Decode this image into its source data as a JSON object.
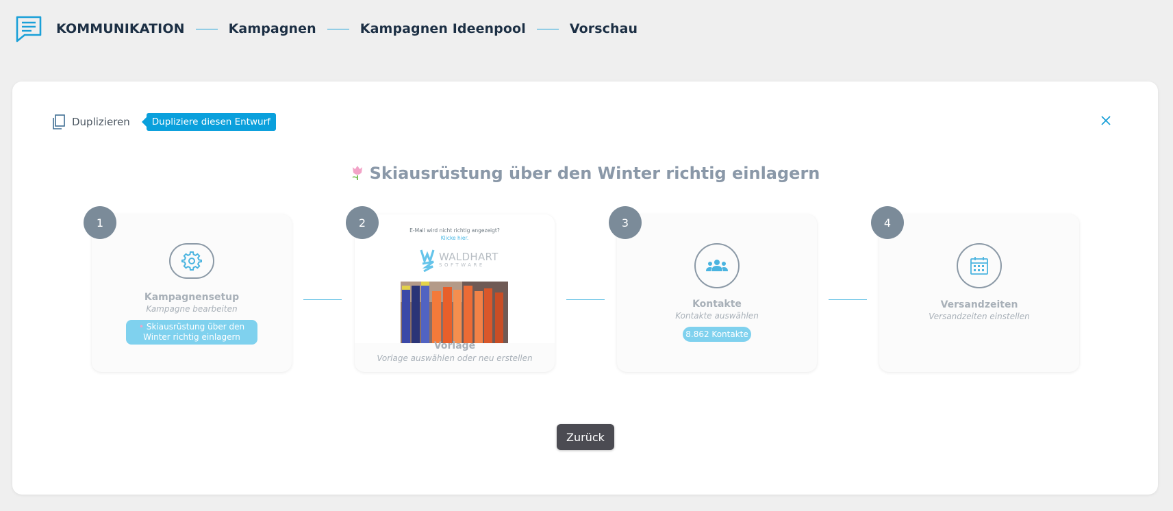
{
  "breadcrumb": {
    "items": [
      "KOMMUNIKATION",
      "Kampagnen",
      "Kampagnen Ideenpool",
      "Vorschau"
    ]
  },
  "toolbar": {
    "duplicate_label": "Duplizieren",
    "duplicate_tooltip": "Dupliziere diesen Entwurf"
  },
  "campaign": {
    "title": "Skiausrüstung über den Winter richtig einlagern"
  },
  "steps": [
    {
      "number": "1",
      "title": "Kampagnensetup",
      "subtitle": "Kampagne bearbeiten",
      "badge": "Skiausrüstung über den Winter richtig einlagern"
    },
    {
      "number": "2",
      "title": "Vorlage",
      "subtitle": "Vorlage auswählen oder neu erstellen",
      "preview_text": "E-Mail wird nicht richtig angezeigt?",
      "preview_link": "Klicke hier.",
      "logo_main": "WALDHART",
      "logo_sub": "SOFTWARE"
    },
    {
      "number": "3",
      "title": "Kontakte",
      "subtitle": "Kontakte auswählen",
      "badge": "8.862 Kontakte"
    },
    {
      "number": "4",
      "title": "Versandzeiten",
      "subtitle": "Versandzeiten einstellen"
    }
  ],
  "footer": {
    "back_label": "Zurück"
  },
  "colors": {
    "accent": "#0aa0dc",
    "step_number_bg": "#7b8b99",
    "badge_bg": "#7fd1ee",
    "back_button_bg": "#4b4b52"
  },
  "icons": {
    "header": "chat-message-icon",
    "duplicate": "copy-icon",
    "close": "close-icon",
    "title": "tulip-icon",
    "step1": "gear-icon",
    "step3": "contacts-icon",
    "step4": "calendar-icon"
  }
}
